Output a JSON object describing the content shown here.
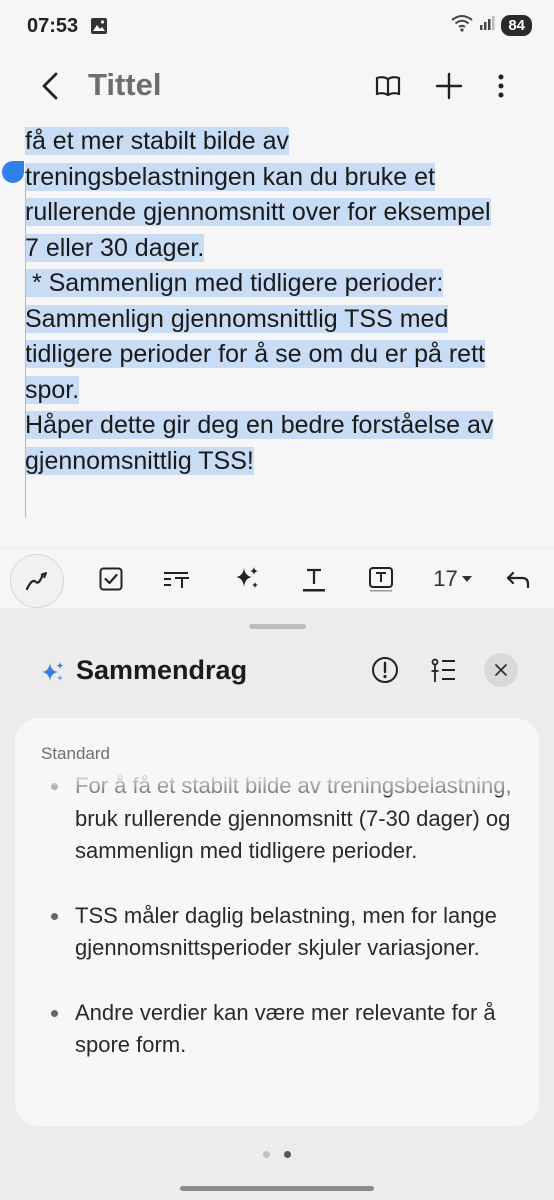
{
  "status_bar": {
    "time": "07:53",
    "battery": "84"
  },
  "header": {
    "title": "Tittel"
  },
  "editor": {
    "lines": [
      "få et mer stabilt bilde av",
      "treningsbelastningen kan du bruke et",
      "rullerende gjennomsnitt over for eksempel",
      "7 eller 30 dager.",
      " * Sammenlign med tidligere perioder:",
      "Sammenlign gjennomsnittlig TSS med",
      "tidligere perioder for å se om du er på rett",
      "spor.",
      "Håper dette gir deg en bedre forståelse av",
      "gjennomsnittlig TSS!"
    ]
  },
  "toolbar": {
    "font_size": "17"
  },
  "summary": {
    "title": "Sammendrag",
    "label": "Standard",
    "bullets": [
      "For å få et stabilt bilde av treningsbelastning, bruk rullerende gjennomsnitt (7-30 dager) og sammenlign med tidligere perioder.",
      "TSS måler daglig belastning, men for lange gjennomsnittsperioder skjuler variasjoner.",
      "Andre verdier kan være mer relevante for å spore form."
    ]
  },
  "colors": {
    "selection": "#c8dcf6",
    "handle": "#2f80ea",
    "accent_star": "#3b7be0"
  }
}
